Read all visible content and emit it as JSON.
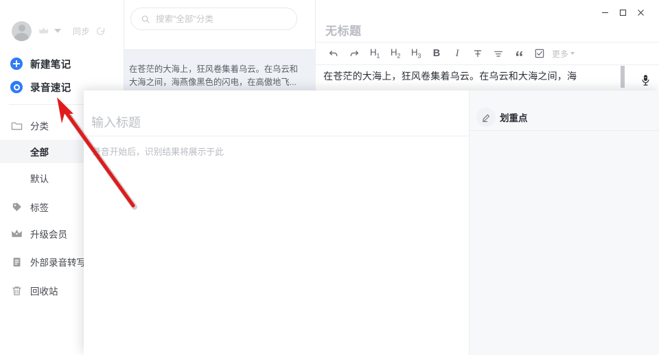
{
  "sidebar": {
    "account": {
      "avatar_name": "user-avatar",
      "crown_icon": "crown-icon",
      "dropdown_icon": "chevron-down-icon",
      "sync_label": "同步",
      "sync_icon": "refresh-spinner-icon"
    },
    "actions": [
      {
        "label": "新建笔记",
        "icon": "plus-circle-icon"
      },
      {
        "label": "录音速记",
        "icon": "record-circle-icon"
      }
    ],
    "nav": [
      {
        "label": "分类",
        "icon": "folder-icon",
        "type": "group"
      },
      {
        "label": "全部",
        "type": "sub",
        "selected": true
      },
      {
        "label": "默认",
        "type": "sub",
        "selected": false
      },
      {
        "label": "标签",
        "icon": "tag-icon",
        "type": "group"
      },
      {
        "label": "升级会员",
        "icon": "crown-icon",
        "type": "group"
      },
      {
        "label": "外部录音转写",
        "icon": "audio-file-icon",
        "type": "group"
      },
      {
        "label": "回收站",
        "icon": "trash-icon",
        "type": "group"
      }
    ]
  },
  "notelist": {
    "search": {
      "placeholder": "搜索\"全部\"分类",
      "value": "",
      "icon": "search-icon"
    },
    "notes": [
      {
        "snippet": "在苍茫的大海上，狂风卷集着乌云。在乌云和大海之间，海燕像黑色的闪电，在高傲地飞..."
      }
    ]
  },
  "editor": {
    "window_controls": {
      "minimize": "minimize-icon",
      "maximize": "maximize-icon",
      "close": "close-icon"
    },
    "title": "无标题",
    "toolbar": [
      {
        "label": "undo",
        "icon": "undo-icon"
      },
      {
        "label": "redo",
        "icon": "redo-icon"
      },
      {
        "label": "H1",
        "icon": "heading-1-icon"
      },
      {
        "label": "H2",
        "icon": "heading-2-icon"
      },
      {
        "label": "H3",
        "icon": "heading-3-icon"
      },
      {
        "label": "B",
        "icon": "bold-icon"
      },
      {
        "label": "I",
        "icon": "italic-icon"
      },
      {
        "label": "strikethrough",
        "icon": "strikethrough-icon"
      },
      {
        "label": "align",
        "icon": "align-icon"
      },
      {
        "label": "quote",
        "icon": "quote-icon"
      },
      {
        "label": "checkbox",
        "icon": "checkbox-icon"
      }
    ],
    "more_label": "更多",
    "body_text": "在苍茫的大海上，狂风卷集着乌云。在乌云和大海之间，海",
    "mic_icon": "microphone-icon",
    "scrollbar": "vertical-scrollbar"
  },
  "modal": {
    "controls": {
      "restore": "restore-window-icon",
      "close": "close-icon"
    },
    "title_placeholder": "输入标题",
    "title_value": "",
    "hint": "录音开始后，识别结果将展示于此",
    "right_panel": {
      "icon": "pen-highlight-icon",
      "label": "划重点"
    }
  },
  "annotation": {
    "arrow_color": "#e01b1b",
    "arrow_name": "red-pointer-arrow"
  },
  "colors": {
    "accent": "#2f7bf6",
    "panel_bg": "#f7f8fa",
    "selected_row": "#f4f5f7",
    "note_selected": "#eef1f6",
    "border": "#e9eaec",
    "annotation_red": "#e01b1b"
  }
}
